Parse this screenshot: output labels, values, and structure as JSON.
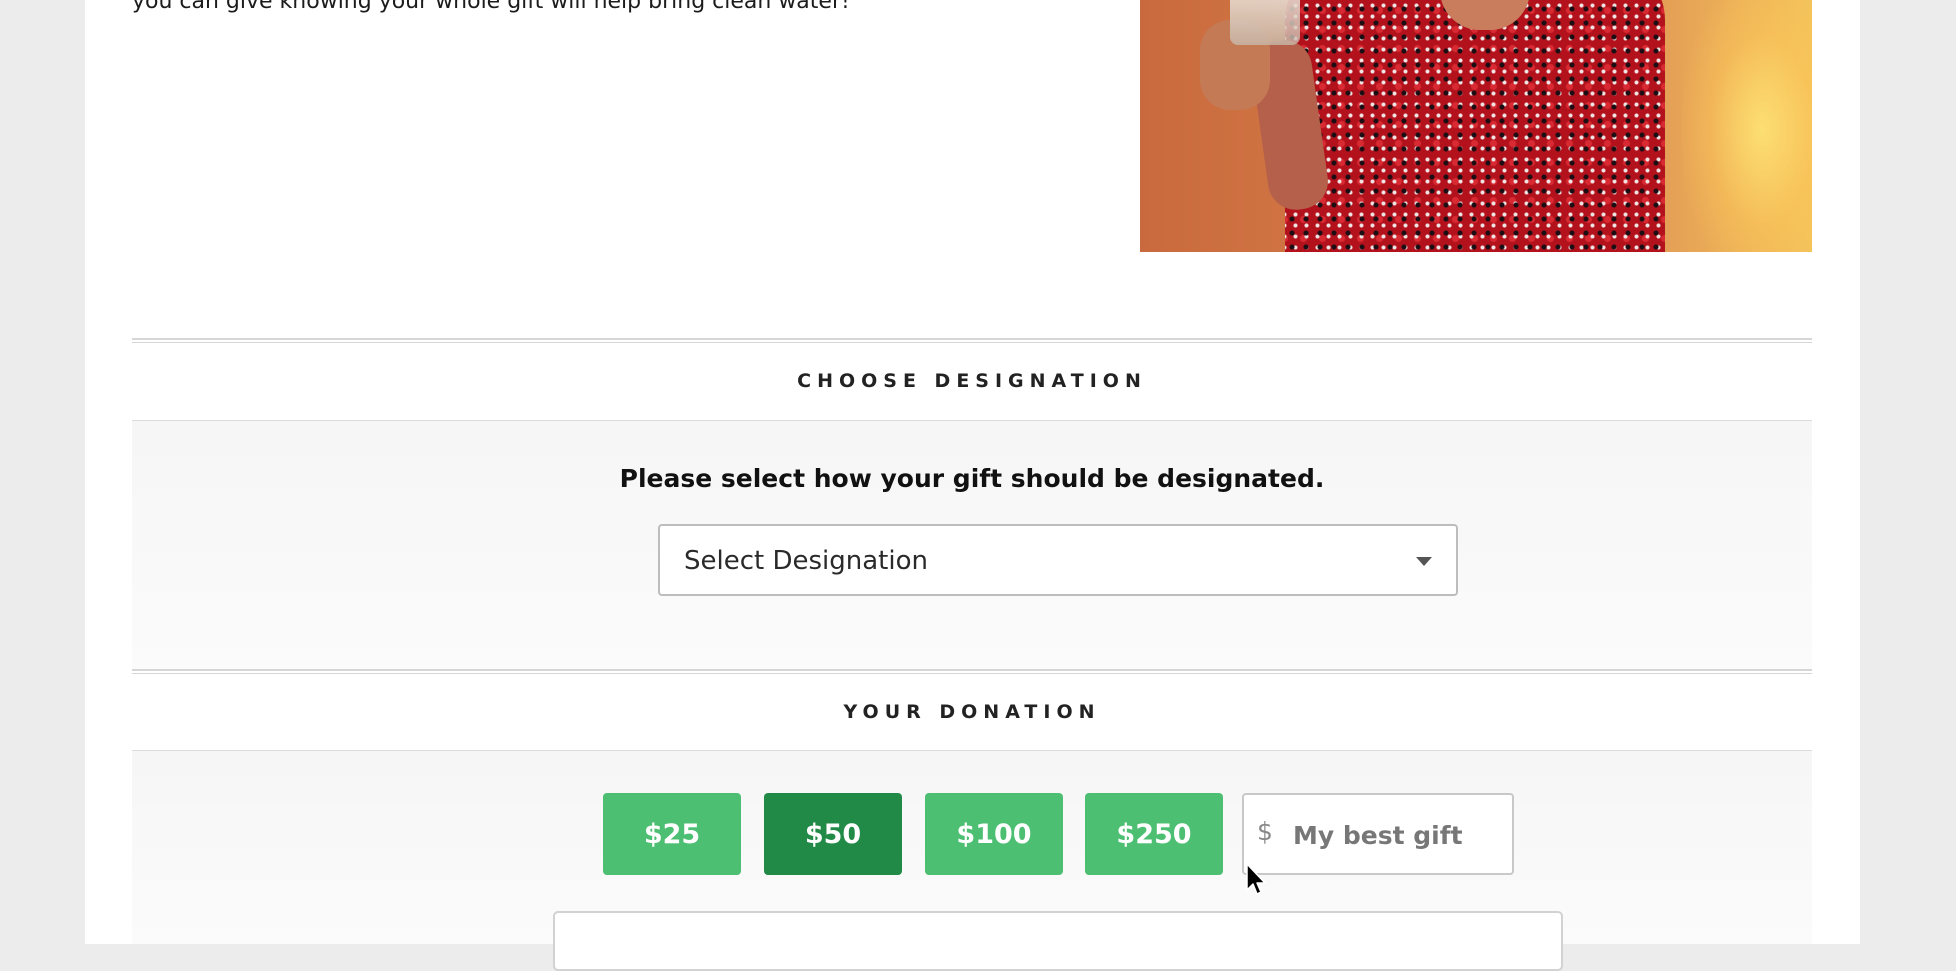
{
  "intro": {
    "text": "you can give knowing your whole gift will help bring clean water!"
  },
  "designation": {
    "heading": "CHOOSE DESIGNATION",
    "prompt": "Please select how your gift should be designated.",
    "select_value": "Select Designation"
  },
  "donation": {
    "heading": "YOUR DONATION",
    "amounts": [
      {
        "label": "$25",
        "selected": false
      },
      {
        "label": "$50",
        "selected": true
      },
      {
        "label": "$100",
        "selected": false
      },
      {
        "label": "$250",
        "selected": false
      }
    ],
    "custom": {
      "currency": "$",
      "placeholder": "My best gift"
    }
  },
  "colors": {
    "button_green": "#4dbf72",
    "button_selected_green": "#228a47",
    "page_background": "#ececec"
  },
  "icons": {
    "select_caret": "caret-down-icon",
    "cursor": "mouse-pointer-icon"
  }
}
